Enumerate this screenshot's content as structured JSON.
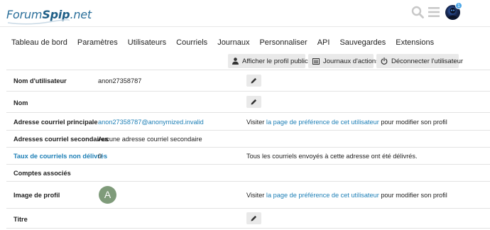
{
  "header": {
    "logo_prefix": "Forum",
    "logo_brand": "Spip",
    "logo_suffix": ".net",
    "notification_count": "1",
    "icons": [
      "search-icon",
      "hamburger-menu-icon",
      "user-avatar"
    ]
  },
  "tabs": [
    {
      "label": "Tableau de bord"
    },
    {
      "label": "Paramètres"
    },
    {
      "label": "Utilisateurs"
    },
    {
      "label": "Courriels"
    },
    {
      "label": "Journaux"
    },
    {
      "label": "Personnaliser"
    },
    {
      "label": "API"
    },
    {
      "label": "Sauvegardes"
    },
    {
      "label": "Extensions"
    }
  ],
  "actions": {
    "public_profile": "Afficher le profil public",
    "action_logs": "Journaux d'actions",
    "log_out_user": "Déconnecter l'utilisateur"
  },
  "rows": {
    "username": {
      "label": "Nom d'utilisateur",
      "value": "anon27358787"
    },
    "name": {
      "label": "Nom",
      "value": ""
    },
    "primary_email": {
      "label": "Adresse courriel principale",
      "value": "anon27358787@anonymized.invalid",
      "info_prefix": "Visiter ",
      "info_link": "la page de préférence de cet utilisateur",
      "info_suffix": " pour modifier son profil"
    },
    "secondary_emails": {
      "label": "Adresses courriel secondaires",
      "value": "Aucune adresse courriel secondaire"
    },
    "bounce_score": {
      "label": "Taux de courriels non délivrés",
      "value": "0",
      "info": "Tous les courriels envoyés à cette adresse ont été délivrés."
    },
    "associated_accounts": {
      "label": "Comptes associés"
    },
    "profile_picture": {
      "label": "Image de profil",
      "avatar_letter": "A",
      "info_prefix": "Visiter ",
      "info_link": "la page de préférence de cet utilisateur",
      "info_suffix": " pour modifier son profil"
    },
    "title": {
      "label": "Titre"
    }
  },
  "colors": {
    "link": "#1d7fb6",
    "button_bg": "#e9e9e9",
    "avatar_bg": "#7f9b7a",
    "logo": "#2b6f9a",
    "badge": "#4fa8e8"
  }
}
